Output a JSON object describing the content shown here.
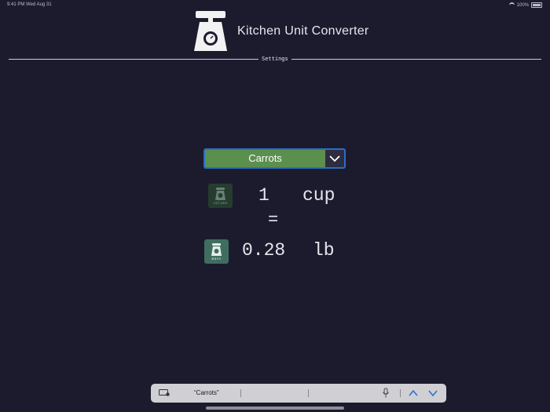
{
  "status_bar": {
    "time": "9:41 PM  Wed Aug 31",
    "battery": "100%"
  },
  "header": {
    "title": "Kitchen Unit Converter"
  },
  "settings": {
    "label": "Settings"
  },
  "ingredient": {
    "selected": "Carrots"
  },
  "conversion": {
    "from_value": "1",
    "from_unit": "cup",
    "equals": "=",
    "to_value": "0.28",
    "to_unit": "lb",
    "from_icon_label": "volume",
    "to_icon_label": "mass"
  },
  "keyboard_bar": {
    "suggestion": "“Carrots”"
  },
  "colors": {
    "background": "#1c1b2e",
    "dropdown": "#5b8f4e",
    "focus": "#2a6ec8",
    "icon": "#3f6e60"
  }
}
